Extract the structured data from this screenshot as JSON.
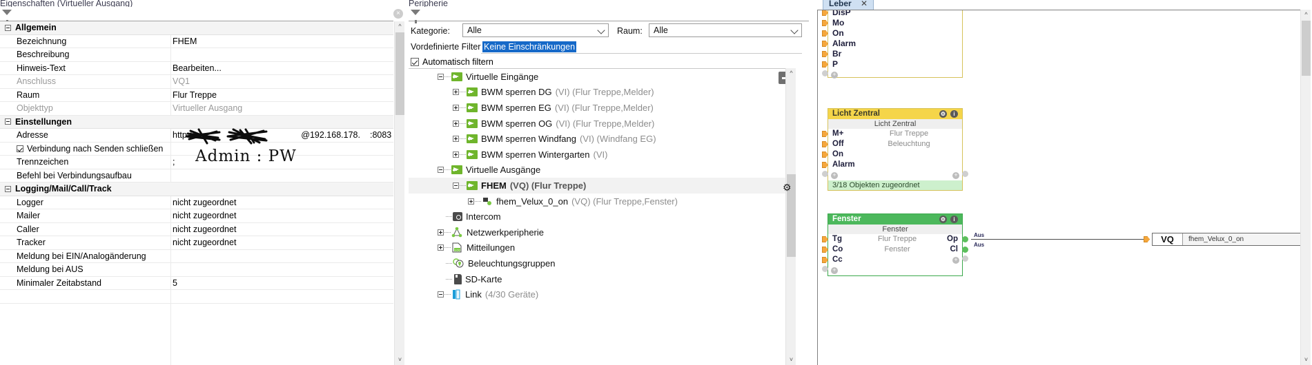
{
  "left_panel": {
    "title": "Eigenschaften (Virtueller Ausgang)",
    "filter_icon": "funnel-icon",
    "close_icon": "×",
    "rows": [
      {
        "kind": "group",
        "name": "Allgemein",
        "value": ""
      },
      {
        "kind": "item",
        "name": "Bezeichnung",
        "value": "FHEM"
      },
      {
        "kind": "item",
        "name": "Beschreibung",
        "value": ""
      },
      {
        "kind": "item",
        "name": "Hinweis-Text",
        "value": "Bearbeiten..."
      },
      {
        "kind": "item",
        "name": "Anschluss",
        "value": "VQ1",
        "dim": true
      },
      {
        "kind": "item",
        "name": "Raum",
        "value": "Flur Treppe"
      },
      {
        "kind": "item",
        "name": "Objekttyp",
        "value": "Virtueller Ausgang",
        "dim": true
      },
      {
        "kind": "group",
        "name": "Einstellungen",
        "value": ""
      },
      {
        "kind": "item",
        "name": "Adresse",
        "value": "http://"
      },
      {
        "kind": "check",
        "name": "Verbindung nach Senden schließen",
        "value": "",
        "checked": true
      },
      {
        "kind": "item",
        "name": "Trennzeichen",
        "value": ";"
      },
      {
        "kind": "item",
        "name": "Befehl bei Verbindungsaufbau",
        "value": ""
      },
      {
        "kind": "group",
        "name": "Logging/Mail/Call/Track",
        "value": ""
      },
      {
        "kind": "item",
        "name": "Logger",
        "value": "nicht zugeordnet"
      },
      {
        "kind": "item",
        "name": "Mailer",
        "value": "nicht zugeordnet"
      },
      {
        "kind": "item",
        "name": "Caller",
        "value": "nicht zugeordnet"
      },
      {
        "kind": "item",
        "name": "Tracker",
        "value": "nicht zugeordnet"
      },
      {
        "kind": "item",
        "name": "Meldung bei EIN/Analogänderung",
        "value": ""
      },
      {
        "kind": "item",
        "name": "Meldung bei AUS",
        "value": ""
      },
      {
        "kind": "item",
        "name": "Minimaler Zeitabstand",
        "value": "5"
      },
      {
        "kind": "item",
        "name": "",
        "value": ""
      }
    ],
    "address_suffix": "@192.168.178.",
    "address_port": ":8083",
    "annotation": "Admin : PW"
  },
  "mid_panel": {
    "title": "Peripherie",
    "filter_icon": "funnel-icon",
    "close_icon": "×",
    "kategorie_label": "Kategorie:",
    "kategorie_value": "Alle",
    "raum_label": "Raum:",
    "raum_value": "Alle",
    "vordefinierte_label": "Vordefinierte Filter",
    "vordefinierte_value": "Keine Einschränkungen",
    "auto_filter_label": "Automatisch filtern",
    "auto_filter_checked": true,
    "collapse_button": "minus-button",
    "tree": [
      {
        "indent": 1,
        "state": "minus",
        "icon": "green-arrow-icon",
        "label": "Virtuelle Eingänge",
        "meta": "",
        "selected": false
      },
      {
        "indent": 2,
        "state": "plus",
        "icon": "green-arrow-icon",
        "label": "BWM sperren DG",
        "meta": "(VI) (Flur Treppe,Melder)",
        "selected": false
      },
      {
        "indent": 2,
        "state": "plus",
        "icon": "green-arrow-icon",
        "label": "BWM sperren EG",
        "meta": "(VI) (Flur Treppe,Melder)",
        "selected": false
      },
      {
        "indent": 2,
        "state": "plus",
        "icon": "green-arrow-icon",
        "label": "BWM sperren OG",
        "meta": "(VI) (Flur Treppe,Melder)",
        "selected": false
      },
      {
        "indent": 2,
        "state": "plus",
        "icon": "green-arrow-icon",
        "label": "BWM sperren Windfang",
        "meta": "(VI) (Windfang EG)",
        "selected": false
      },
      {
        "indent": 2,
        "state": "plus",
        "icon": "green-arrow-icon",
        "label": "BWM sperren Wintergarten",
        "meta": "(VI)",
        "selected": false
      },
      {
        "indent": 1,
        "state": "minus",
        "icon": "green-arrow-icon",
        "label": "Virtuelle Ausgänge",
        "meta": "",
        "selected": false
      },
      {
        "indent": 2,
        "state": "minus",
        "icon": "green-arrow-icon",
        "label": "FHEM",
        "meta": "(VQ) (Flur Treppe)",
        "selected": true
      },
      {
        "indent": 3,
        "state": "plus",
        "icon": "plug-icon",
        "label": "fhem_Velux_0_on",
        "meta": "(VQ) (Flur Treppe,Fenster)",
        "selected": false
      },
      {
        "indent": 1,
        "state": "leaf",
        "icon": "intercom-icon",
        "label": "Intercom",
        "meta": "",
        "selected": false
      },
      {
        "indent": 1,
        "state": "plus",
        "icon": "network-icon",
        "label": "Netzwerkperipherie",
        "meta": "",
        "selected": false
      },
      {
        "indent": 1,
        "state": "plus",
        "icon": "log-document-icon",
        "label": "Mitteilungen",
        "meta": "",
        "selected": false
      },
      {
        "indent": 1,
        "state": "leaf",
        "icon": "lightbulb-group-icon",
        "label": "Beleuchtungsgruppen",
        "meta": "",
        "selected": false
      },
      {
        "indent": 1,
        "state": "leaf",
        "icon": "sd-card-icon",
        "label": "SD-Karte",
        "meta": "",
        "selected": false
      },
      {
        "indent": 1,
        "state": "minus",
        "icon": "link-icon",
        "label": "Link",
        "meta": "(4/30 Geräte)",
        "selected": false
      }
    ]
  },
  "right_panel": {
    "tab_label": "Leber",
    "tab_close": "✕",
    "blocks": [
      {
        "name": "top-block",
        "color": "yellow",
        "title": "",
        "subtitle": "",
        "left_pins": [
          "DisP",
          "Mo",
          "On",
          "Alarm",
          "Br",
          "P"
        ],
        "right_pins": [],
        "footer": ""
      },
      {
        "name": "licht-zentral-block",
        "color": "yellow",
        "title": "Licht Zentral",
        "subtitle": "Licht Zentral",
        "center_lines": [
          "Flur Treppe",
          "Beleuchtung"
        ],
        "left_pins": [
          "M+",
          "Off",
          "On",
          "Alarm"
        ],
        "right_pins": [],
        "footer": "3/18 Objekten zugeordnet",
        "gear_icon": "gear-icon",
        "info_icon": "info-icon"
      },
      {
        "name": "fenster-block",
        "color": "green",
        "title": "Fenster",
        "subtitle": "Fenster",
        "center_lines": [
          "Flur Treppe",
          "Fenster"
        ],
        "left_pins": [
          "Tg",
          "Co",
          "Cc"
        ],
        "right_pins": [
          "Op",
          "Cl"
        ],
        "footer": "",
        "gear_icon": "gear-icon",
        "info_icon": "info-icon"
      }
    ],
    "wire_labels": [
      "Aus",
      "Aus"
    ],
    "vq_block": {
      "tag": "VQ",
      "name": "fhem_Velux_0_on"
    }
  }
}
